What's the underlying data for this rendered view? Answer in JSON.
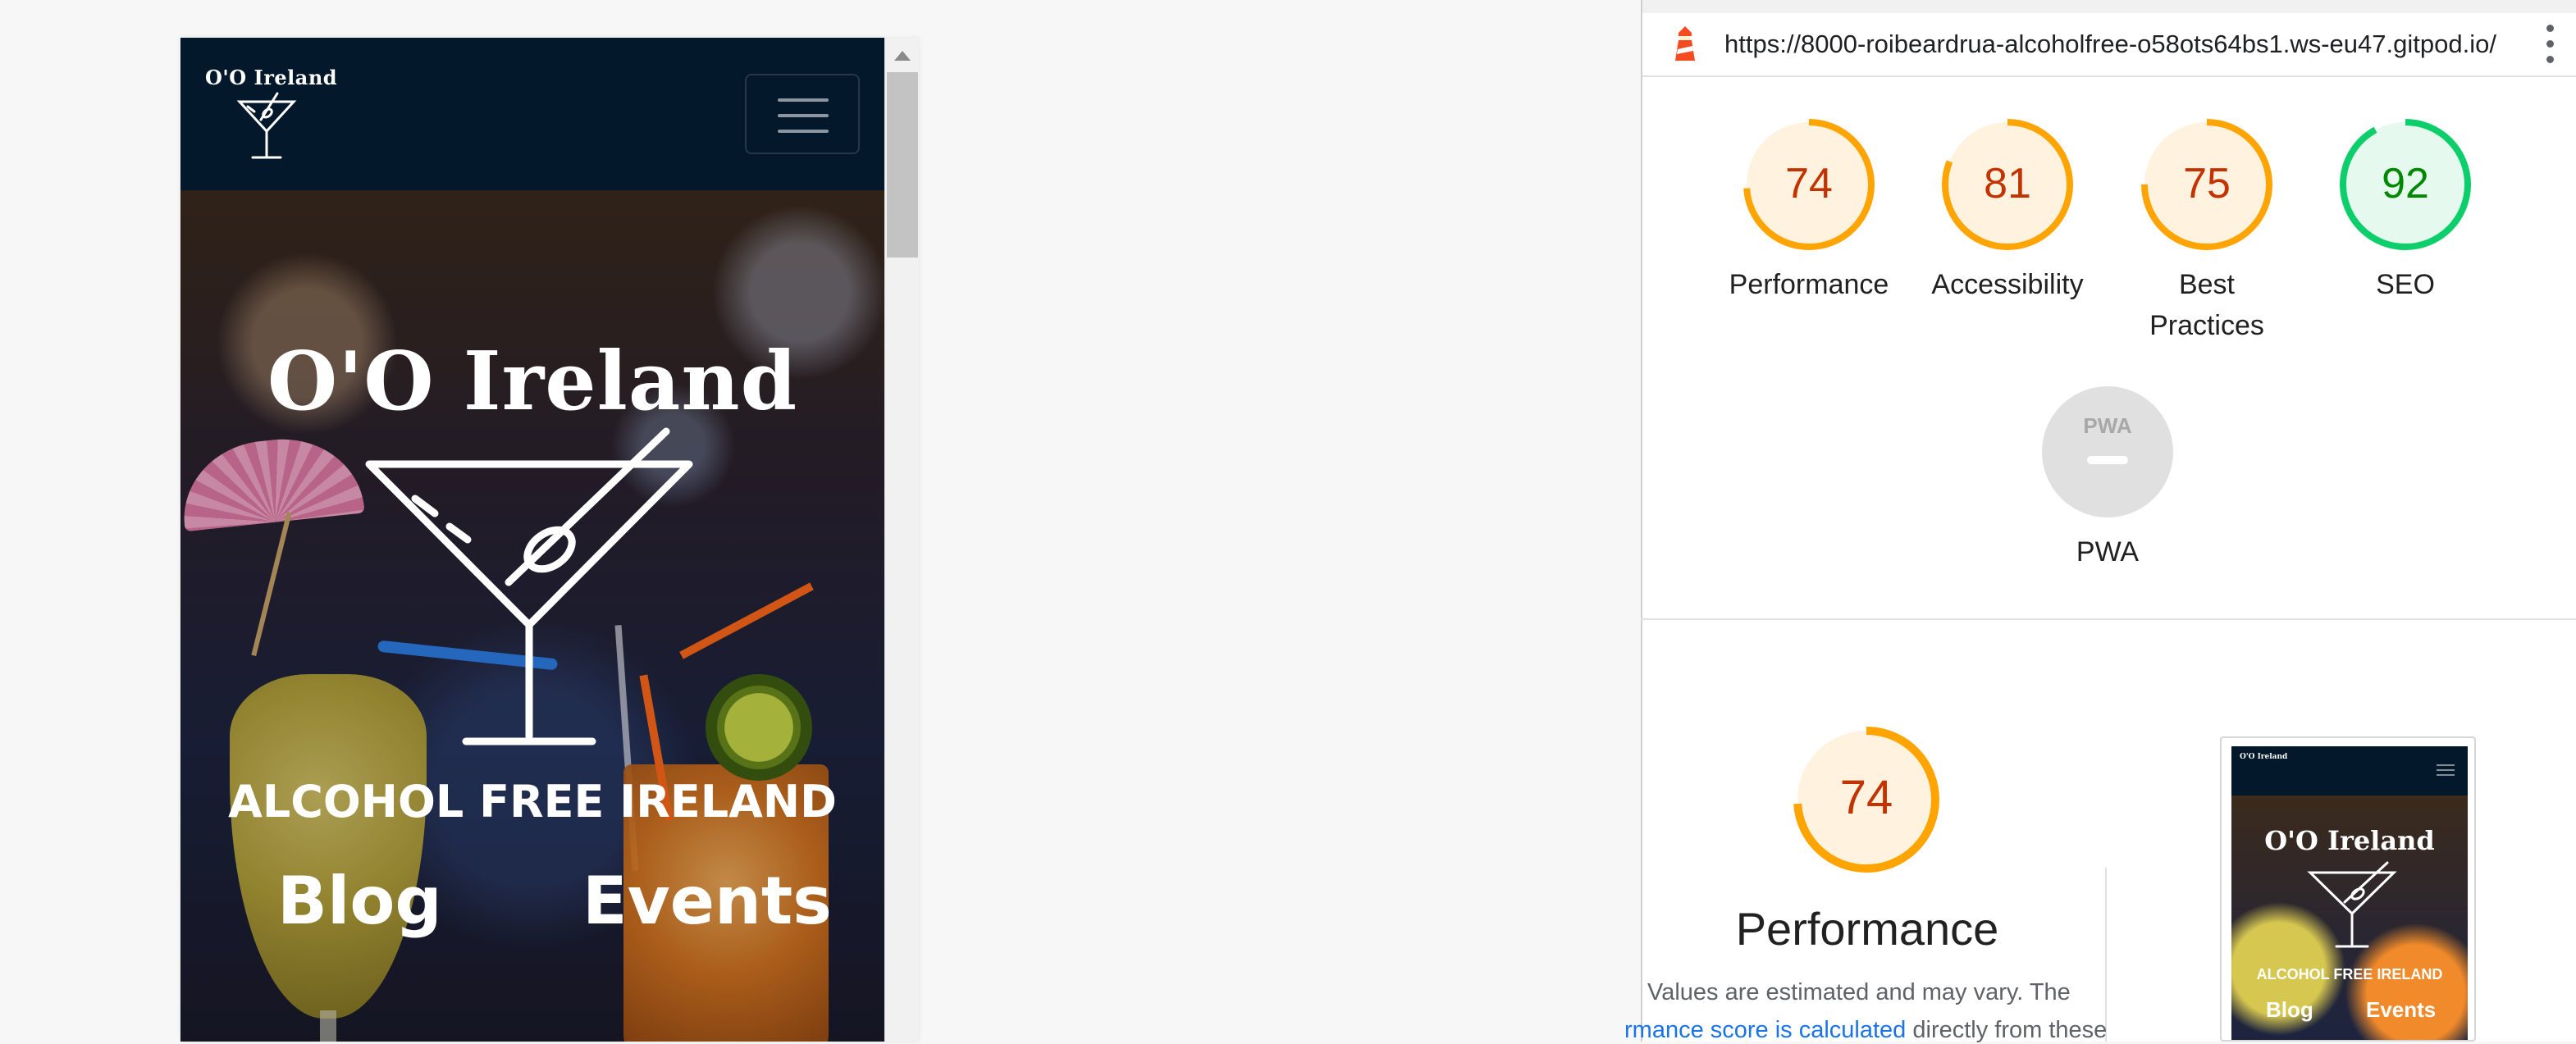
{
  "site": {
    "brand": "O'O Ireland",
    "hero_title": "O'O Ireland",
    "tagline": "ALCOHOL FREE IRELAND",
    "links": [
      "Blog",
      "Events"
    ]
  },
  "report": {
    "url": "https://8000-roibeardrua-alcoholfree-o58ots64bs1.ws-eu47.gitpod.io/",
    "scores": [
      {
        "label": "Performance",
        "score": 74,
        "status": "average"
      },
      {
        "label": "Accessibility",
        "score": 81,
        "status": "average"
      },
      {
        "label": "Best Practices",
        "score": 75,
        "status": "average"
      },
      {
        "label": "SEO",
        "score": 92,
        "status": "pass"
      }
    ],
    "pwa": {
      "label": "PWA",
      "badge": "PWA"
    },
    "performance": {
      "score": 74,
      "title": "Performance",
      "note": "Values are estimated and may vary. The",
      "link_text": "rmance score is calculated",
      "link_rest": " directly from these"
    }
  },
  "colors": {
    "average": "#ffa400",
    "average_text": "#c33300",
    "average_bg": "#fff3e0",
    "pass": "#0cce6b",
    "pass_text": "#008800",
    "pass_bg": "#e6f9ef",
    "navbar": "#03182a",
    "link": "#1a73e8"
  },
  "icons": {
    "lighthouse": "lighthouse-icon",
    "menu": "more-vert-icon",
    "toggler": "hamburger-icon",
    "logo": "cocktail-glass-icon"
  }
}
